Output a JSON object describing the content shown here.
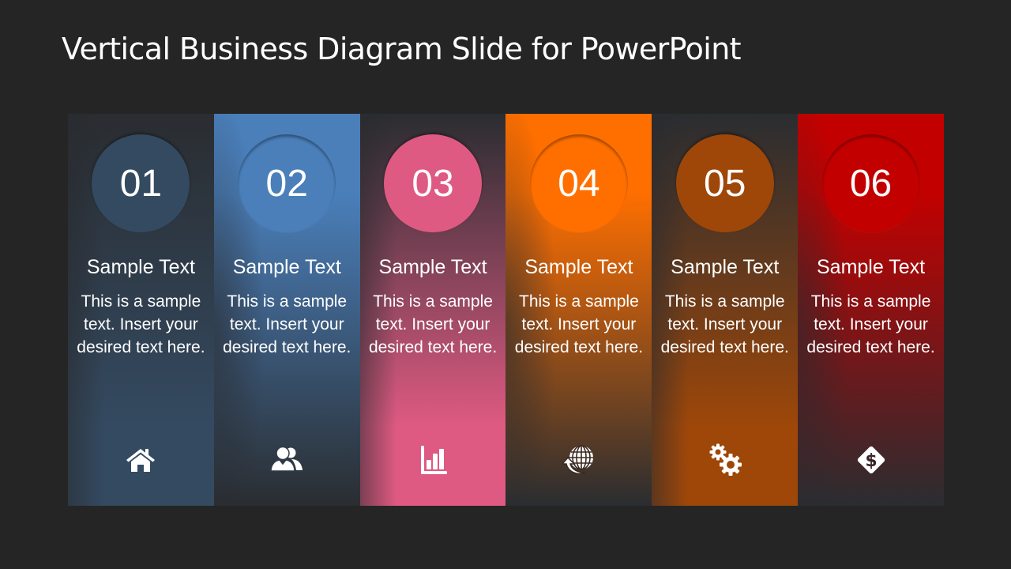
{
  "slide": {
    "title": "Vertical Business Diagram Slide for PowerPoint",
    "background": "#252525"
  },
  "columns": [
    {
      "number": "01",
      "heading": "Sample Text",
      "body": "This is a sample text. Insert your desired text here.",
      "icon": "home-icon",
      "color": "#344a61",
      "style": "odd"
    },
    {
      "number": "02",
      "heading": "Sample Text",
      "body": "This is a sample text. Insert your desired text here.",
      "icon": "users-icon",
      "color": "#4a7fba",
      "style": "even"
    },
    {
      "number": "03",
      "heading": "Sample Text",
      "body": "This is a sample text. Insert your desired text here.",
      "icon": "bar-chart-icon",
      "color": "#df5a82",
      "style": "odd"
    },
    {
      "number": "04",
      "heading": "Sample Text",
      "body": "This is a sample text. Insert your desired text here.",
      "icon": "globe-arrow-icon",
      "color": "#ff6f00",
      "style": "even"
    },
    {
      "number": "05",
      "heading": "Sample Text",
      "body": "This is a sample text. Insert your desired text here.",
      "icon": "gears-icon",
      "color": "#9e4709",
      "style": "odd"
    },
    {
      "number": "06",
      "heading": "Sample Text",
      "body": "This is a sample text. Insert your desired text here.",
      "icon": "dollar-diamond-icon",
      "color": "#c30000",
      "style": "even"
    }
  ]
}
